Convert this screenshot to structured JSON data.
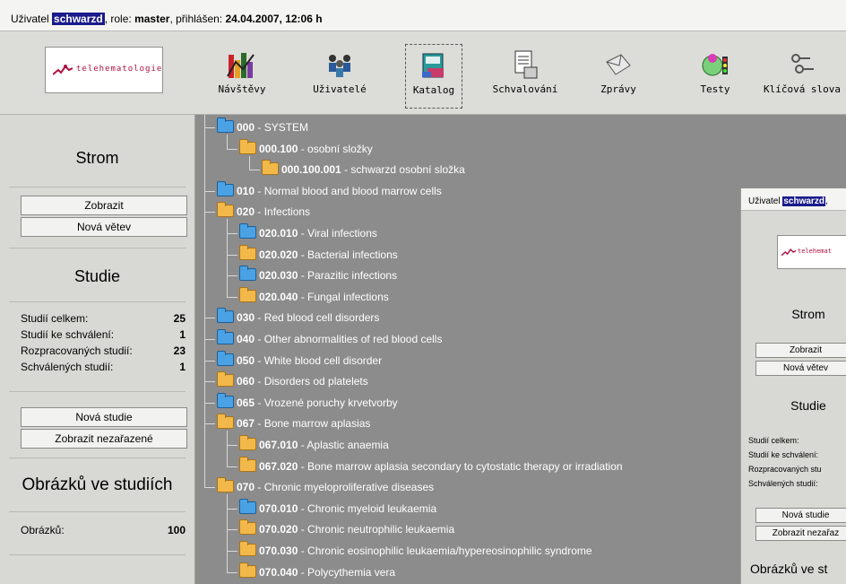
{
  "header": {
    "user_prefix": "Uživatel",
    "username": "schwarzd",
    "role_label": ", role:",
    "role": "master",
    "login_label": ", přihlášen:",
    "login_time": "24.04.2007, 12:06 h"
  },
  "logo_text": "telehematologie",
  "toolbar": [
    {
      "label": "Návštěvy",
      "icon": "bar-chart-icon"
    },
    {
      "label": "Uživatelé",
      "icon": "users-icon"
    },
    {
      "label": "Katalog",
      "icon": "catalog-icon",
      "selected": true
    },
    {
      "label": "Schvalování",
      "icon": "approval-icon"
    },
    {
      "label": "Zprávy",
      "icon": "envelope-icon"
    },
    {
      "label": "Testy",
      "icon": "test-icon"
    },
    {
      "label": "Klíčová slova",
      "icon": "keys-icon"
    }
  ],
  "sidebar": {
    "tree_title": "Strom",
    "btn_show": "Zobrazit",
    "btn_new_branch": "Nová větev",
    "studies_title": "Studie",
    "stats": [
      {
        "label": "Studií celkem:",
        "value": "25"
      },
      {
        "label": "Studií ke schválení:",
        "value": "1"
      },
      {
        "label": "Rozpracovaných studií:",
        "value": "23"
      },
      {
        "label": "Schválených studií:",
        "value": "1"
      }
    ],
    "btn_new_study": "Nová studie",
    "btn_show_unassigned": "Zobrazit nezařazené",
    "images_title": "Obrázků ve studiích",
    "images_label": "Obrázků:",
    "images_value": "100"
  },
  "tree": [
    {
      "code": "000",
      "name": " - SYSTEM",
      "level": 0,
      "color": "blue"
    },
    {
      "code": "000.100",
      "name": " - osobní složky",
      "level": 1,
      "color": "orange"
    },
    {
      "code": "000.100.001",
      "name": " - schwarzd osobní složka",
      "level": 2,
      "color": "orange"
    },
    {
      "code": "010",
      "name": " - Normal blood and blood marrow cells",
      "level": 0,
      "color": "blue"
    },
    {
      "code": "020",
      "name": " - Infections",
      "level": 0,
      "color": "orange"
    },
    {
      "code": "020.010",
      "name": " - Viral infections",
      "level": 1,
      "color": "blue"
    },
    {
      "code": "020.020",
      "name": " - Bacterial infections",
      "level": 1,
      "color": "orange"
    },
    {
      "code": "020.030",
      "name": " - Parazitic infections",
      "level": 1,
      "color": "blue"
    },
    {
      "code": "020.040",
      "name": " - Fungal infections",
      "level": 1,
      "color": "orange"
    },
    {
      "code": "030",
      "name": " - Red blood cell disorders",
      "level": 0,
      "color": "blue"
    },
    {
      "code": "040",
      "name": " - Other abnormalities of red blood cells",
      "level": 0,
      "color": "blue"
    },
    {
      "code": "050",
      "name": " - White blood cell disorder",
      "level": 0,
      "color": "blue"
    },
    {
      "code": "060",
      "name": " - Disorders od platelets",
      "level": 0,
      "color": "orange"
    },
    {
      "code": "065",
      "name": " - Vrozené poruchy krvetvorby",
      "level": 0,
      "color": "blue"
    },
    {
      "code": "067",
      "name": " - Bone marrow aplasias",
      "level": 0,
      "color": "orange"
    },
    {
      "code": "067.010",
      "name": " - Aplastic anaemia",
      "level": 1,
      "color": "orange"
    },
    {
      "code": "067.020",
      "name": " - Bone marrow aplasia secondary to cytostatic therapy or irradiation",
      "level": 1,
      "color": "orange"
    },
    {
      "code": "070",
      "name": " - Chronic myeloproliferative diseases",
      "level": 0,
      "color": "orange"
    },
    {
      "code": "070.010",
      "name": " - Chronic myeloid leukaemia",
      "level": 1,
      "color": "blue"
    },
    {
      "code": "070.020",
      "name": " - Chronic neutrophilic leukaemia",
      "level": 1,
      "color": "orange"
    },
    {
      "code": "070.030",
      "name": " - Chronic eosinophilic leukaemia/hypereosinophilic syndrome",
      "level": 1,
      "color": "orange"
    },
    {
      "code": "070.040",
      "name": " - Polycythemia vera",
      "level": 1,
      "color": "orange"
    }
  ],
  "overlay": {
    "user_prefix": "Uživatel",
    "username": "schwarzd",
    "user_suffix": ",",
    "logo_text": "telehemat",
    "tree_title": "Strom",
    "btn_show": "Zobrazit",
    "btn_new_branch": "Nová větev",
    "studies_title": "Studie",
    "stats": [
      "Studií celkem:",
      "Studií ke schválení:",
      "Rozpracovaných stu",
      "Schválených studií:"
    ],
    "btn_new_study": "Nová studie",
    "btn_show_unassigned": "Zobrazit nezařaz",
    "images_title": "Obrázků ve st"
  }
}
